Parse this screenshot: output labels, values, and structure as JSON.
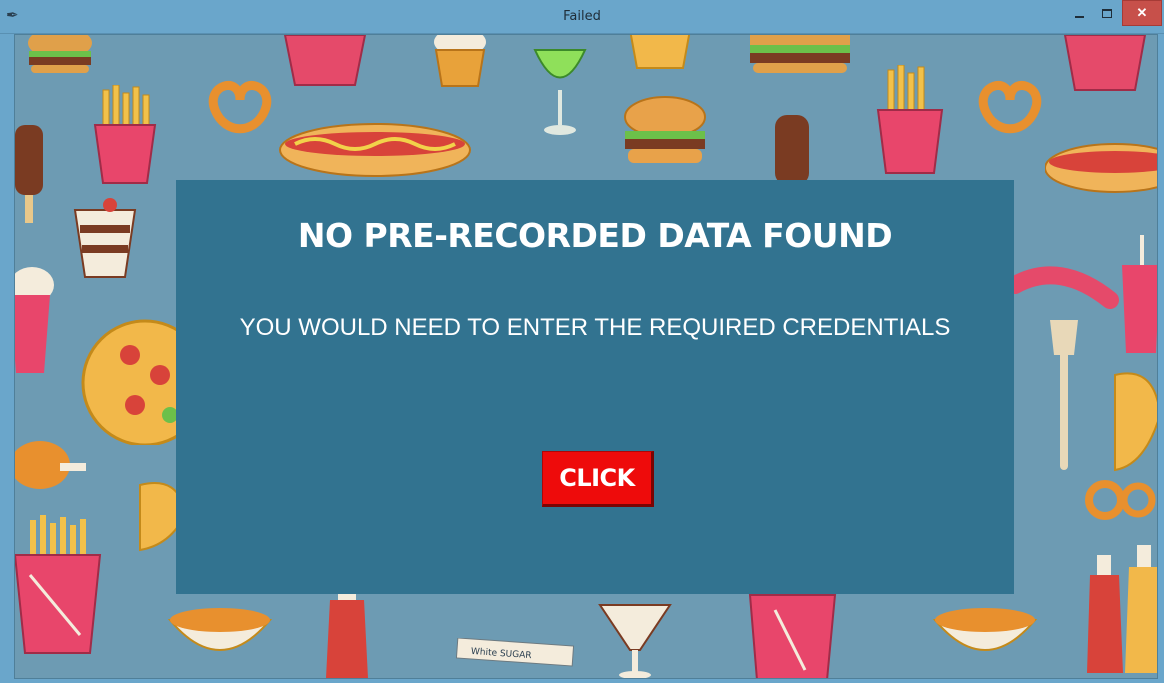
{
  "window": {
    "title": "Failed",
    "icon": "feather-icon",
    "controls": {
      "minimize": "minimize-icon",
      "maximize": "maximize-icon",
      "close": "close-icon",
      "close_glyph": "✕"
    }
  },
  "dialog": {
    "heading": "NO PRE-RECORDED DATA FOUND",
    "message": "YOU WOULD NEED TO ENTER THE REQUIRED CREDENTIALS",
    "button_label": "CLICK"
  },
  "background": {
    "label_sugar": "White SUGAR"
  },
  "colors": {
    "panel": "#327390",
    "button": "#ee0b0b",
    "background": "#6d9bb3"
  }
}
